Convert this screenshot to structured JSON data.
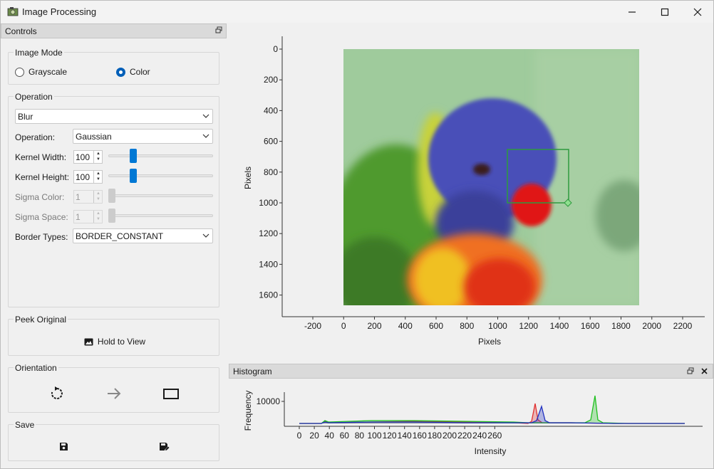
{
  "window": {
    "title": "Image Processing"
  },
  "controls_panel": {
    "title": "Controls"
  },
  "image_mode": {
    "label": "Image Mode",
    "options": [
      {
        "label": "Grayscale",
        "selected": false
      },
      {
        "label": "Color",
        "selected": true
      }
    ]
  },
  "operation_group": {
    "label": "Operation",
    "selected_operation": "Blur",
    "rows": {
      "operation_label": "Operation:",
      "operation_value": "Gaussian",
      "kernel_width_label": "Kernel Width:",
      "kernel_width_value": "100",
      "kernel_height_label": "Kernel Height:",
      "kernel_height_value": "100",
      "sigma_color_label": "Sigma Color:",
      "sigma_color_value": "1",
      "sigma_space_label": "Sigma Space:",
      "sigma_space_value": "1",
      "border_types_label": "Border Types:",
      "border_types_value": "BORDER_CONSTANT"
    }
  },
  "peek_original": {
    "label": "Peek Original",
    "button_label": "Hold to View"
  },
  "orientation": {
    "label": "Orientation"
  },
  "save": {
    "label": "Save"
  },
  "image_plot": {
    "x_axis_label": "Pixels",
    "y_axis_label": "Pixels",
    "x_ticks": [
      "-200",
      "0",
      "200",
      "400",
      "600",
      "800",
      "1000",
      "1200",
      "1400",
      "1600",
      "1800",
      "2000",
      "2200"
    ],
    "y_ticks": [
      "0",
      "200",
      "400",
      "600",
      "800",
      "1000",
      "1200",
      "1400",
      "1600"
    ],
    "selection_color": "#2e9a3e"
  },
  "histogram": {
    "title": "Histogram",
    "x_axis_label": "Intensity",
    "y_axis_label": "Frequency",
    "y_tick": "10000",
    "x_ticks": [
      "0",
      "20",
      "40",
      "60",
      "80",
      "100",
      "120",
      "140",
      "160",
      "180",
      "200",
      "220",
      "240",
      "260"
    ],
    "series_colors": {
      "red": "#e03030",
      "green": "#20c020",
      "blue": "#2030c0"
    }
  }
}
